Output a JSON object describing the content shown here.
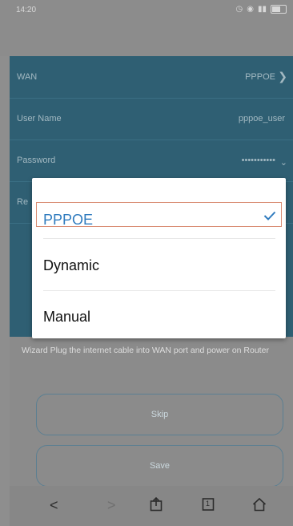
{
  "status_bar": {
    "time": "14:20"
  },
  "settings": {
    "rows": [
      {
        "label": "WAN",
        "value": "PPPOE"
      },
      {
        "label": "User Name",
        "value": "pppoe_user"
      },
      {
        "label": "Password",
        "value": "•••••••••••"
      },
      {
        "label": "Re"
      }
    ]
  },
  "note": "Wizard Plug the internet cable into WAN port and power on Router",
  "buttons": {
    "skip": "Skip",
    "save": "Save"
  },
  "dialog": {
    "options": [
      {
        "label": "PPPOE"
      },
      {
        "label": "Dynamic"
      },
      {
        "label": "Manual"
      }
    ],
    "selected": "PPPOE",
    "check_color": "#2f7bbe"
  },
  "nav": {
    "back": "<",
    "forward": ">",
    "page": "1"
  },
  "colors": {
    "panel": "#2f5f73",
    "accent": "#2f7bbe",
    "highlight_border": "#d98d73"
  }
}
